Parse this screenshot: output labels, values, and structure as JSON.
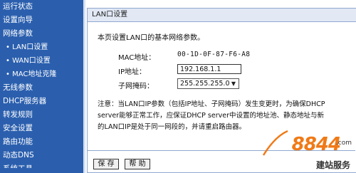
{
  "sidebar": {
    "items": [
      {
        "label": "运行状态"
      },
      {
        "label": "设置向导"
      },
      {
        "label": "网络参数"
      },
      {
        "label": "• LAN口设置"
      },
      {
        "label": "• WAN口设置"
      },
      {
        "label": "• MAC地址克隆"
      },
      {
        "label": "无线参数"
      },
      {
        "label": "DHCP服务器"
      },
      {
        "label": "转发规则"
      },
      {
        "label": "安全设置"
      },
      {
        "label": "路由功能"
      },
      {
        "label": "动态DNS"
      },
      {
        "label": "系统工具"
      }
    ]
  },
  "panel": {
    "title": "LAN口设置",
    "intro": "本页设置LAN口的基本网络参数。",
    "mac_label": "MAC地址：",
    "mac_value": "00-1D-0F-87-F6-A8",
    "ip_label": "IP地址：",
    "ip_value": "192.168.1.1",
    "mask_label": "子网掩码：",
    "mask_value": "255.255.255.0",
    "note_lines": [
      "注意：当LAN口IP参数（包括IP地址、子网掩码）发生变更时，为确保DHCP",
      "server能够正常工作，应保证DHCP server中设置的地址池、静态地址与新",
      "的LAN口IP是处于同一网段的，并请重启路由器。"
    ]
  },
  "footer": {
    "save_label": "保 存",
    "help_label": "帮 助"
  },
  "watermark": {
    "logo": "8844",
    "domain": ".com",
    "sub": "建站服务"
  },
  "colors": {
    "sidebar_bg": "#2b5fae",
    "panel_border": "#8fa8cf",
    "watermark": "#f07a17"
  }
}
